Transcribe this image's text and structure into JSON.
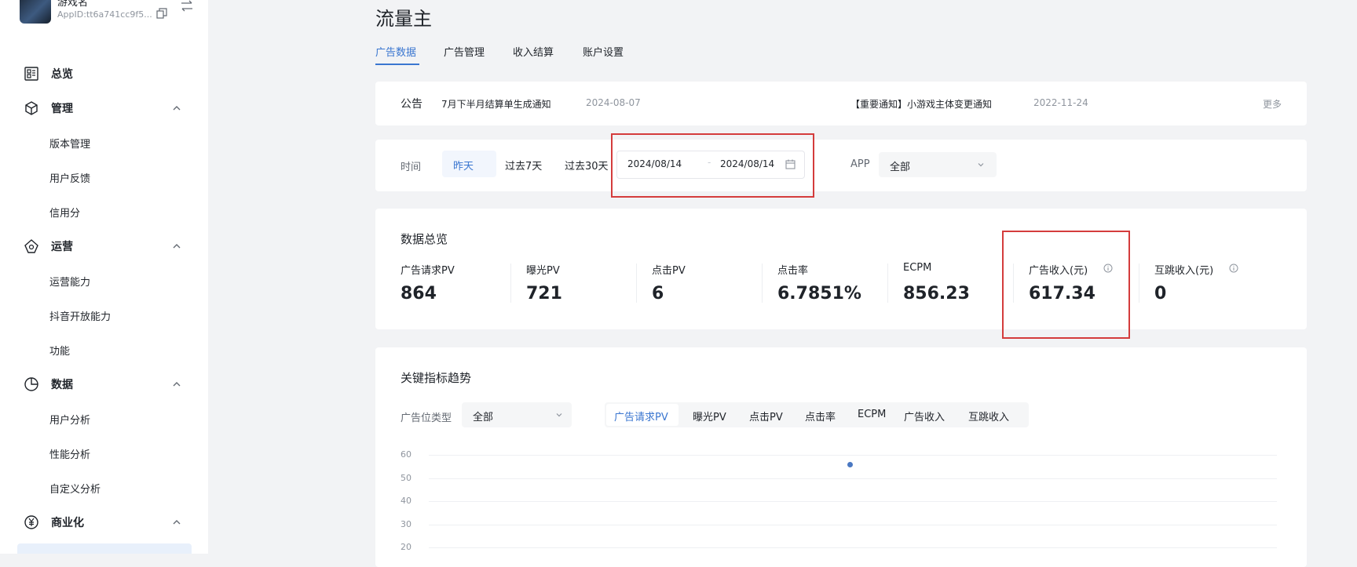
{
  "sidebar": {
    "app": {
      "name": "游戏名",
      "appid": "AppID:tt6a741cc9f5..."
    },
    "groups": [
      {
        "label": "总览",
        "icon": "dashboard-icon"
      },
      {
        "label": "管理",
        "icon": "cube-icon",
        "items": [
          "版本管理",
          "用户反馈",
          "信用分"
        ]
      },
      {
        "label": "运营",
        "icon": "operations-icon",
        "items": [
          "运营能力",
          "抖音开放能力",
          "功能"
        ]
      },
      {
        "label": "数据",
        "icon": "pie-chart-icon",
        "items": [
          "用户分析",
          "性能分析",
          "自定义分析"
        ]
      },
      {
        "label": "商业化",
        "icon": "yuan-icon"
      }
    ]
  },
  "page": {
    "title": "流量主",
    "tabs": [
      "广告数据",
      "广告管理",
      "收入结算",
      "账户设置"
    ],
    "active_tab": "广告数据"
  },
  "notice": {
    "label": "公告",
    "items": [
      {
        "text": "7月下半月结算单生成通知",
        "date": "2024-08-07"
      },
      {
        "text": "【重要通知】小游戏主体变更通知",
        "date": "2022-11-24"
      }
    ],
    "more": "更多"
  },
  "filter": {
    "time_label": "时间",
    "quick_options": [
      "昨天",
      "过去7天",
      "过去30天"
    ],
    "selected_quick": "昨天",
    "date_start": "2024/08/14",
    "date_separator": "-",
    "date_end": "2024/08/14",
    "app_label": "APP",
    "app_value": "全部"
  },
  "overview": {
    "title": "数据总览",
    "metrics": [
      {
        "label": "广告请求PV",
        "value": "864"
      },
      {
        "label": "曝光PV",
        "value": "721"
      },
      {
        "label": "点击PV",
        "value": "6"
      },
      {
        "label": "点击率",
        "value": "6.7851%"
      },
      {
        "label": "ECPM",
        "value": "856.23"
      },
      {
        "label": "广告收入(元)",
        "value": "617.34",
        "info": true
      },
      {
        "label": "互跳收入(元)",
        "value": "0",
        "info": true
      }
    ]
  },
  "trend": {
    "title": "关键指标趋势",
    "ad_type_label": "广告位类型",
    "ad_type_value": "全部",
    "metric_tabs": [
      "广告请求PV",
      "曝光PV",
      "点击PV",
      "点击率",
      "ECPM",
      "广告收入",
      "互跳收入"
    ],
    "active_metric": "广告请求PV",
    "y_ticks": [
      "60",
      "50",
      "40",
      "30",
      "20"
    ]
  },
  "chart_data": {
    "type": "scatter",
    "title": "",
    "xlabel": "",
    "ylabel": "",
    "y_ticks": [
      60,
      50,
      40,
      30,
      20
    ],
    "ylim": [
      20,
      60
    ],
    "grid": true,
    "series": [
      {
        "values": [
          {
            "y": 56
          }
        ]
      }
    ]
  },
  "colors": {
    "accent": "#3a76d0",
    "highlight_box": "#d43c3c",
    "point": "#4a78c2"
  }
}
